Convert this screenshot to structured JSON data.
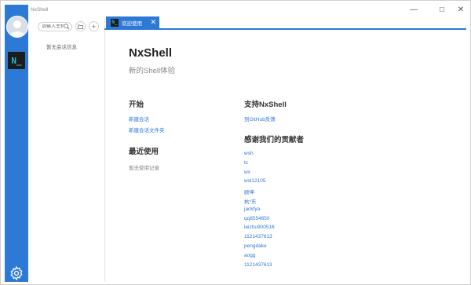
{
  "app": {
    "title": "NxShell"
  },
  "window_controls": {
    "minimize": "—",
    "maximize": "☐",
    "close": "✕"
  },
  "leftbar": {
    "logo_text": "N_",
    "icons": [
      "avatar-icon",
      "app-logo-icon",
      "gear-icon"
    ]
  },
  "sidebar": {
    "search_placeholder": "请输入主机",
    "no_session": "暂无会话信息",
    "buttons": [
      "search-icon",
      "folder-icon",
      "plus-icon"
    ]
  },
  "tab": {
    "icon_text": "N_",
    "label": "欢迎使用",
    "close": "✕"
  },
  "welcome": {
    "title": "NxShell",
    "subtitle": "新的Shell体验",
    "start": {
      "heading": "开始",
      "links": [
        "新建会话",
        "新建会话文件夹"
      ]
    },
    "recent": {
      "heading": "最近使用",
      "empty": "暂无使用记录"
    },
    "support": {
      "heading": "支持NxShell",
      "link": "到GitHub反馈"
    },
    "thanks": {
      "heading": "感谢我们的贡献者",
      "contributors": [
        "wsh",
        "tc",
        "wx",
        "wsl12105",
        "顾坤",
        "杭*东",
        "jackfya",
        "qq8554650",
        "leizhu900516",
        "1121437613",
        "pengdake",
        "aogg",
        "1121437613"
      ]
    }
  },
  "colors": {
    "accent": "#2d7ad6",
    "logo_bg": "#1c1c1c",
    "logo_fg": "#2bb5c9"
  }
}
